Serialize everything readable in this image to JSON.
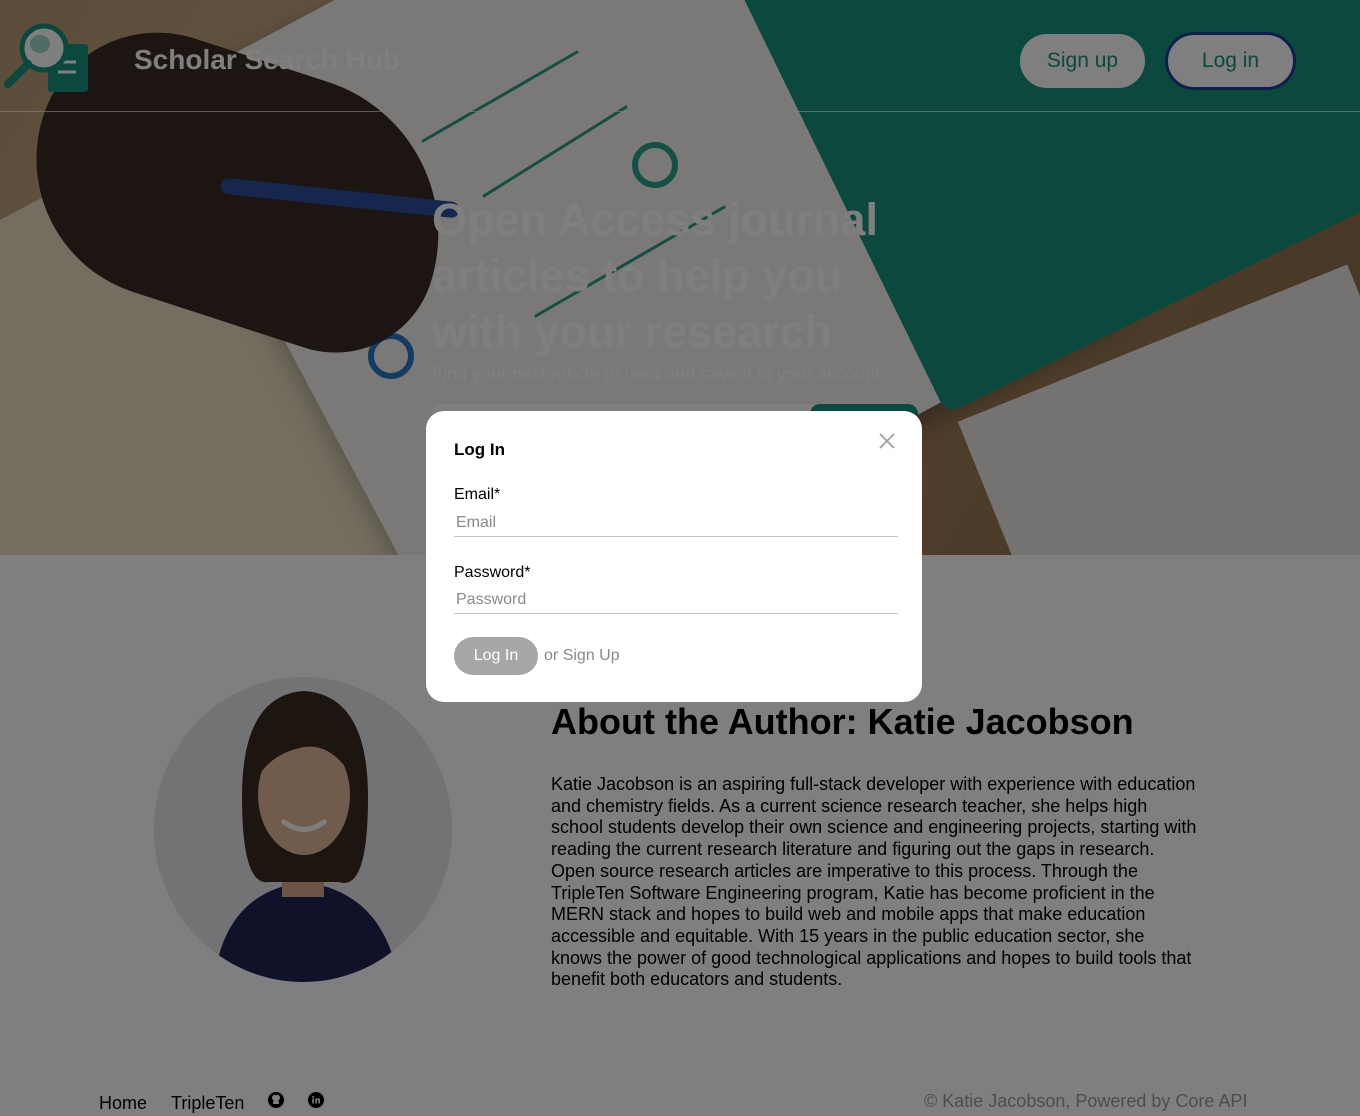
{
  "header": {
    "site_title": "Scholar Search Hub",
    "signup_label": "Sign up",
    "login_label": "Log in"
  },
  "hero": {
    "title": "Open Access journal articles to help you with your research",
    "subtitle": "Find your next article to read and save it to your account"
  },
  "about": {
    "title": "About the Author: Katie Jacobson",
    "body": "Katie Jacobson is an aspiring full-stack developer with experience with education and chemistry fields. As a current science research teacher, she helps high school students develop their own science and engineering projects, starting with reading the current research literature and figuring out the gaps in research. Open source research articles are imperative to this process. Through the TripleTen Software Engineering program, Katie has become proficient in the MERN stack and hopes to build web and mobile apps that make education accessible and equitable. With 15 years in the public education sector, she knows the power of good technological applications and hopes to build tools that benefit both educators and students."
  },
  "footer": {
    "home_label": "Home",
    "tripleten_label": "TripleTen",
    "github_icon": "github-icon",
    "linkedin_icon": "linkedin-icon",
    "copyright": "© Katie Jacobson, Powered by Core API"
  },
  "modal": {
    "title": "Log In",
    "email_label": "Email*",
    "email_placeholder": "Email",
    "password_label": "Password*",
    "password_placeholder": "Password",
    "submit_label": "Log In",
    "or_text": "or",
    "signup_link": "Sign Up"
  },
  "colors": {
    "brand_teal": "#17907a",
    "login_border": "#1c3f9c",
    "disabled_button": "#a7a7a7",
    "overlay": "rgba(0,0,0,0.5)"
  }
}
